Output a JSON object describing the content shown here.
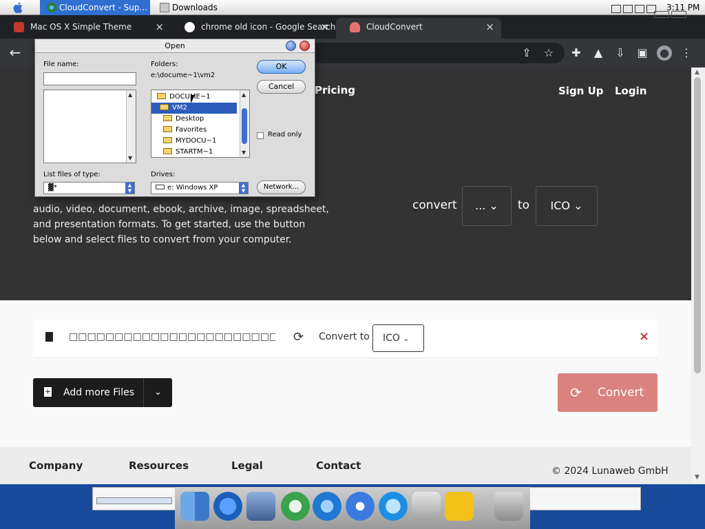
{
  "os": {
    "tabs": [
      {
        "label": "CloudConvert - Sup..."
      },
      {
        "label": "Downloads"
      }
    ],
    "clock": "3:11 PM"
  },
  "browser": {
    "tabs": [
      {
        "label": "Mac OS X Simple Theme",
        "close": "×"
      },
      {
        "label": "chrome old icon - Google Search",
        "close": "×"
      },
      {
        "label": "CloudConvert",
        "close": "×"
      }
    ],
    "back": "←",
    "toolbar_icons": [
      "share-icon",
      "star-icon",
      "puzzle-icon",
      "flask-icon",
      "download-icon",
      "sidepanel-icon",
      "profile-icon",
      "menu-icon"
    ]
  },
  "page": {
    "nav": {
      "pricing": "Pricing",
      "signup": "Sign Up",
      "login": "Login"
    },
    "hero_desc": "audio, video, document, ebook, archive, image, spreadsheet, and presentation formats. To get started, use the button below and select files to convert from your computer.",
    "convert_word": "convert",
    "from_value": "...",
    "to_word": "to",
    "to_value": "ICO",
    "file_row": {
      "file_name": "□□□□□□□□□□□□□□□□□□□□□□□□□□□□□□□□□...",
      "convert_to_label": "Convert to",
      "convert_to_value": "ICO",
      "remove": "×"
    },
    "add_files": "Add more Files",
    "convert_button": "Convert",
    "footer": {
      "company": "Company",
      "resources": "Resources",
      "legal": "Legal",
      "contact": "Contact",
      "copyright": "© 2024 Lunaweb GmbH"
    }
  },
  "dialog": {
    "title": "Open",
    "file_name_label": "File name:",
    "file_name_value": "",
    "folders_label": "Folders:",
    "folders_path": "e:\\docume~1\\vm2",
    "folders": [
      {
        "name": "DOCUME~1",
        "selected": false
      },
      {
        "name": "VM2",
        "selected": true
      },
      {
        "name": "Desktop",
        "selected": false
      },
      {
        "name": "Favorites",
        "selected": false
      },
      {
        "name": "MYDOCU~1",
        "selected": false
      },
      {
        "name": "STARTM~1",
        "selected": false
      }
    ],
    "ok": "OK",
    "cancel": "Cancel",
    "read_only": "Read only",
    "list_files_label": "List files of type:",
    "file_type_value": "▓*",
    "drives_label": "Drives:",
    "drive_value": "e: Windows XP",
    "network": "Network..."
  },
  "colors": {
    "os_tab_active": "#2f6fcf",
    "hero_bg": "#333333",
    "convert_button": "#d9827f",
    "remove_icon": "#c0392b",
    "dialog_selection": "#2d5cbd",
    "dock_bg": "#174a9a"
  }
}
